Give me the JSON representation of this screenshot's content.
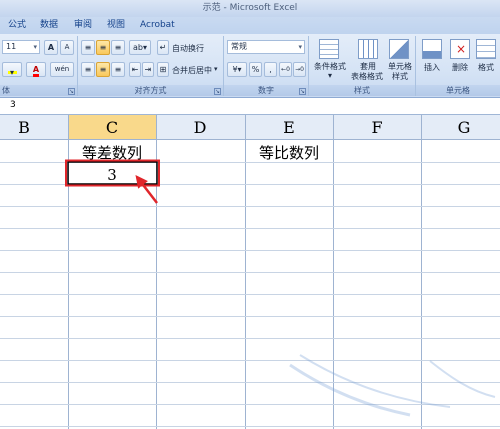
{
  "window": {
    "title": "示范 - Microsoft Excel"
  },
  "tabs": [
    "公式",
    "数据",
    "审阅",
    "视图",
    "Acrobat"
  ],
  "ribbon": {
    "font": {
      "size": "11",
      "grow": "A",
      "shrink": "A",
      "font_color_letter": "A",
      "phonetic": "wén",
      "group_label": "体"
    },
    "alignment": {
      "wrap_text": "自动换行",
      "merge_center": "合并后居中",
      "group_label": "对齐方式"
    },
    "number": {
      "format": "常规",
      "percent": "%",
      "comma": ",",
      "group_label": "数字"
    },
    "styles": {
      "conditional": "条件格式",
      "table_format_1": "套用",
      "table_format_2": "表格格式",
      "cell_style_1": "单元格",
      "cell_style_2": "样式",
      "group_label": "样式"
    },
    "cells": {
      "insert": "插入",
      "delete": "删除",
      "format": "格式",
      "group_label": "单元格"
    }
  },
  "formula_bar": {
    "value": "3"
  },
  "sheet": {
    "columns": [
      "B",
      "C",
      "D",
      "E",
      "F",
      "G"
    ],
    "selected_column": "C",
    "cells": {
      "C1": "等差数列",
      "E1": "等比数列",
      "C2": "3"
    }
  },
  "colors": {
    "selection_box": "#e0262b",
    "annotation_arrow": "#e0262b",
    "selected_header": "#f9d98b"
  }
}
